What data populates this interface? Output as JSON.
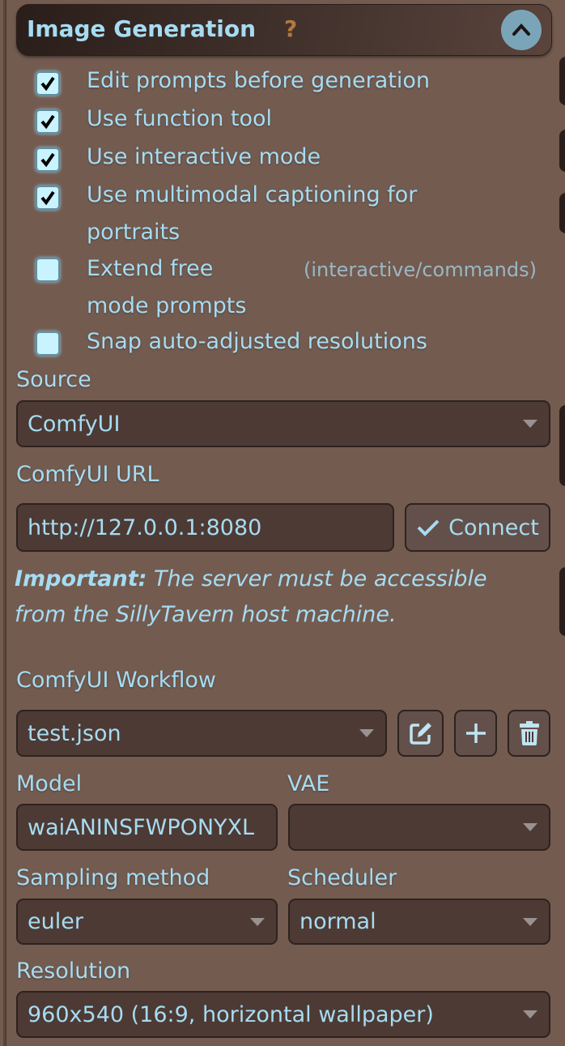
{
  "panel": {
    "title": "Image Generation",
    "help": "?",
    "collapse_icon": "chevron-up-icon"
  },
  "options": [
    {
      "label": "Edit prompts before generation",
      "checked": true
    },
    {
      "label": "Use function tool",
      "checked": true
    },
    {
      "label": "Use interactive mode",
      "checked": true
    },
    {
      "label": "Use multimodal captioning for",
      "label2": "portraits",
      "checked": true
    },
    {
      "label": "Extend free",
      "label2": "mode prompts",
      "hint": "(interactive/commands)",
      "checked": false
    },
    {
      "label": "Snap auto-adjusted resolutions",
      "checked": false
    }
  ],
  "source": {
    "label": "Source",
    "value": "ComfyUI"
  },
  "url": {
    "label": "ComfyUI URL",
    "value": "http://127.0.0.1:8080",
    "connect": "Connect"
  },
  "important": {
    "bold": "Important:",
    "line1": " The server must be accessible",
    "line2": "from the SillyTavern host machine."
  },
  "workflow": {
    "label": "ComfyUI Workflow",
    "value": "test.json"
  },
  "model": {
    "label": "Model",
    "value": "waiANINSFWPONYXL"
  },
  "vae": {
    "label": "VAE",
    "value": ""
  },
  "sampler": {
    "label": "Sampling method",
    "value": "euler"
  },
  "scheduler": {
    "label": "Scheduler",
    "value": "normal"
  },
  "resolution": {
    "label": "Resolution",
    "value": "960x540 (16:9, horizontal wallpaper)"
  },
  "colors": {
    "background": "#735b50",
    "text": "#a6dcf2",
    "field": "#4d3a34",
    "accent": "#7aa5b8",
    "help": "#b07a3c"
  }
}
